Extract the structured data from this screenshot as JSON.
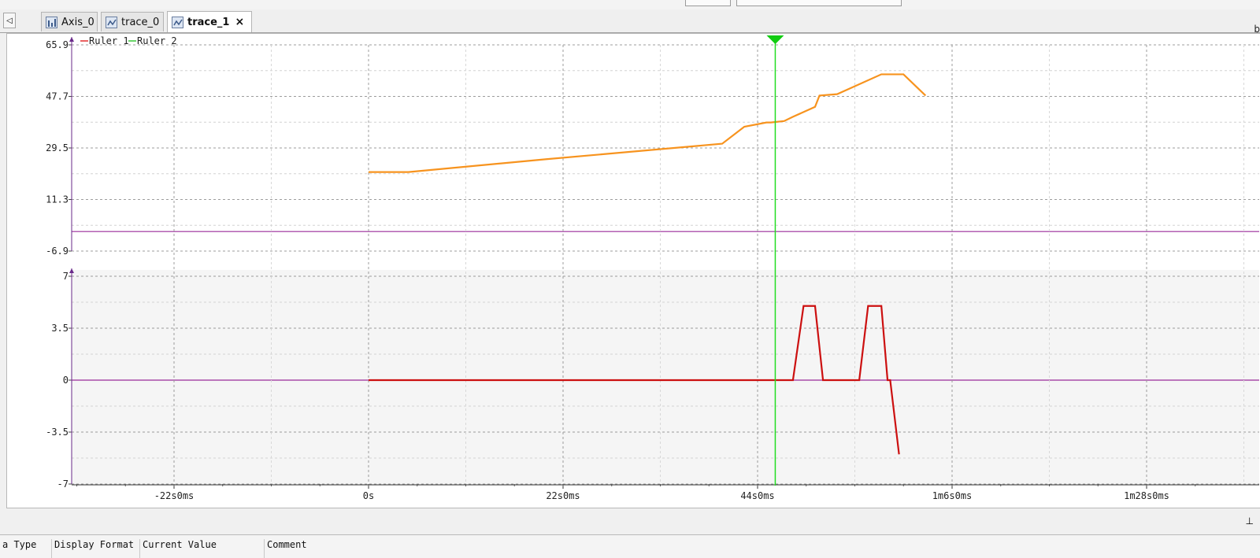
{
  "tabs": [
    {
      "label": "Axis_0",
      "active": false
    },
    {
      "label": "trace_0",
      "active": false
    },
    {
      "label": "trace_1",
      "active": true
    }
  ],
  "tab_close_glyph": "×",
  "scroll_left_glyph": "◁",
  "right_edge_glyph": "b",
  "pin_glyph": "⊥",
  "legend": [
    {
      "name": "Ruler 1",
      "color": "#e02020"
    },
    {
      "name": "Ruler 2",
      "color": "#2bc42b"
    }
  ],
  "columns": [
    "a Type",
    "Display Format",
    "Current Value",
    "Comment"
  ],
  "colors": {
    "upper_trace": "#f7931e",
    "lower_trace": "#cc1010",
    "zero_line": "#9a2a9a",
    "ruler": "#22dd22",
    "lower_panel_bg": "#f5f5f5"
  },
  "chart_data": [
    {
      "type": "line",
      "panel": "upper",
      "ylim": [
        -6.9,
        65.9
      ],
      "y_ticks": [
        "65.9",
        "47.7",
        "29.5",
        "11.3",
        "-6.9"
      ],
      "series": [
        {
          "x": [
            0,
            4.5,
            20,
            40,
            42.5,
            45,
            45.5,
            47,
            48,
            50.5,
            51,
            53,
            58,
            59.5,
            60.5,
            63
          ],
          "y": [
            21,
            21,
            25.5,
            31,
            37,
            38.5,
            38.5,
            39,
            40.5,
            44,
            48,
            48.5,
            55.5,
            55.5,
            55.5,
            48
          ]
        }
      ],
      "reference_line_y": 0
    },
    {
      "type": "line",
      "panel": "lower",
      "ylim": [
        -7,
        7
      ],
      "y_ticks": [
        "7",
        "3.5",
        "0",
        "-3.5",
        "-7"
      ],
      "series": [
        {
          "x": [
            0,
            44,
            44.5,
            46.3,
            47.2,
            48,
            49.2,
            50.5,
            51.4,
            52.4,
            52.7,
            55,
            55.5,
            56.5,
            58,
            58.7,
            59,
            60
          ],
          "y": [
            0,
            0,
            0,
            0,
            0,
            0,
            5,
            5,
            0,
            0,
            0,
            0,
            0,
            5,
            5,
            0,
            0,
            -5
          ]
        }
      ],
      "reference_line_y": 0
    }
  ],
  "x_axis": {
    "ticks": [
      "-22s0ms",
      "0s",
      "22s0ms",
      "44s0ms",
      "1m6s0ms",
      "1m28s0ms"
    ],
    "tick_values": [
      -22,
      0,
      22,
      44,
      66,
      88
    ],
    "xlim": [
      -33,
      97
    ]
  },
  "ruler_x": 46
}
